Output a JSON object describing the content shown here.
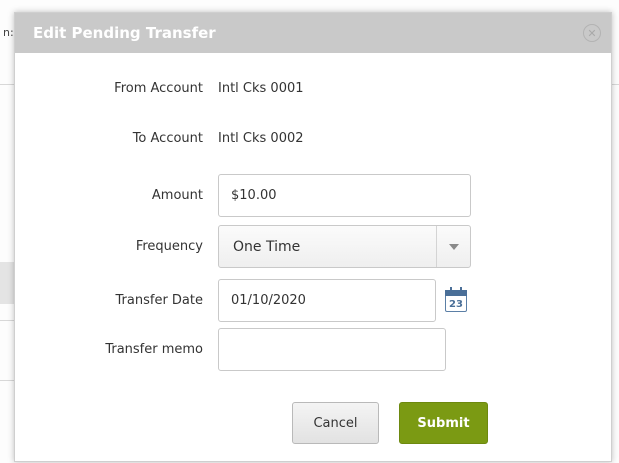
{
  "modal": {
    "title": "Edit Pending Transfer",
    "close_icon": "close-circle-icon"
  },
  "form": {
    "from_account": {
      "label": "From Account",
      "value": "Intl Cks 0001"
    },
    "to_account": {
      "label": "To Account",
      "value": "Intl Cks 0002"
    },
    "amount": {
      "label": "Amount",
      "value": "$10.00"
    },
    "frequency": {
      "label": "Frequency",
      "selected": "One Time"
    },
    "transfer_date": {
      "label": "Transfer Date",
      "value": "01/10/2020",
      "calendar_day": "23",
      "calendar_icon": "calendar-icon"
    },
    "transfer_memo": {
      "label": "Transfer memo",
      "value": ""
    }
  },
  "actions": {
    "cancel_label": "Cancel",
    "submit_label": "Submit"
  },
  "background": {
    "frag_top": "n:"
  },
  "colors": {
    "header_bg": "#c9c9c9",
    "submit_bg": "#7b9a13",
    "calendar_accent": "#4a6f98"
  }
}
